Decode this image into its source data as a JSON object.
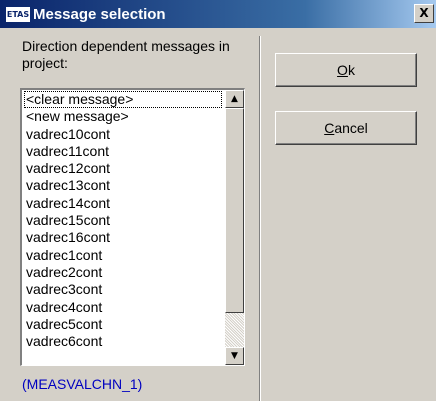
{
  "window": {
    "title": "Message selection",
    "app_icon": "ETAS",
    "close_label": "X"
  },
  "prompt": "Direction dependent messages in project:",
  "list": {
    "items": [
      "<clear message>",
      "<new message>",
      "vadrec10cont",
      "vadrec11cont",
      "vadrec12cont",
      "vadrec13cont",
      "vadrec14cont",
      "vadrec15cont",
      "vadrec16cont",
      "vadrec1cont",
      "vadrec2cont",
      "vadrec3cont",
      "vadrec4cont",
      "vadrec5cont",
      "vadrec6cont"
    ],
    "selected_index": 0
  },
  "footer_label": "(MEASVALCHN_1)",
  "buttons": {
    "ok": {
      "mnemonic": "O",
      "rest": "k"
    },
    "cancel": {
      "mnemonic": "C",
      "rest": "ancel"
    }
  },
  "icons": {
    "scroll_up": "triangle-up-icon",
    "scroll_down": "triangle-down-icon",
    "close": "close-icon"
  },
  "colors": {
    "titlebar_start": "#0a246a",
    "titlebar_end": "#a6caf0",
    "footer_text": "#0000c0",
    "face": "#d4d0c8"
  }
}
